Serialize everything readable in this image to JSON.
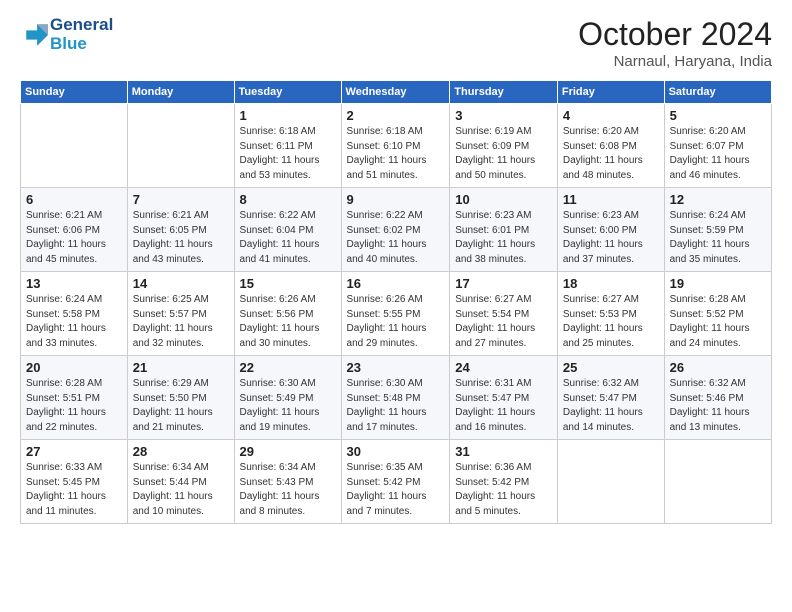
{
  "header": {
    "logo_line1": "General",
    "logo_line2": "Blue",
    "month": "October 2024",
    "location": "Narnaul, Haryana, India"
  },
  "weekdays": [
    "Sunday",
    "Monday",
    "Tuesday",
    "Wednesday",
    "Thursday",
    "Friday",
    "Saturday"
  ],
  "weeks": [
    [
      {
        "day": "",
        "info": ""
      },
      {
        "day": "",
        "info": ""
      },
      {
        "day": "1",
        "info": "Sunrise: 6:18 AM\nSunset: 6:11 PM\nDaylight: 11 hours\nand 53 minutes."
      },
      {
        "day": "2",
        "info": "Sunrise: 6:18 AM\nSunset: 6:10 PM\nDaylight: 11 hours\nand 51 minutes."
      },
      {
        "day": "3",
        "info": "Sunrise: 6:19 AM\nSunset: 6:09 PM\nDaylight: 11 hours\nand 50 minutes."
      },
      {
        "day": "4",
        "info": "Sunrise: 6:20 AM\nSunset: 6:08 PM\nDaylight: 11 hours\nand 48 minutes."
      },
      {
        "day": "5",
        "info": "Sunrise: 6:20 AM\nSunset: 6:07 PM\nDaylight: 11 hours\nand 46 minutes."
      }
    ],
    [
      {
        "day": "6",
        "info": "Sunrise: 6:21 AM\nSunset: 6:06 PM\nDaylight: 11 hours\nand 45 minutes."
      },
      {
        "day": "7",
        "info": "Sunrise: 6:21 AM\nSunset: 6:05 PM\nDaylight: 11 hours\nand 43 minutes."
      },
      {
        "day": "8",
        "info": "Sunrise: 6:22 AM\nSunset: 6:04 PM\nDaylight: 11 hours\nand 41 minutes."
      },
      {
        "day": "9",
        "info": "Sunrise: 6:22 AM\nSunset: 6:02 PM\nDaylight: 11 hours\nand 40 minutes."
      },
      {
        "day": "10",
        "info": "Sunrise: 6:23 AM\nSunset: 6:01 PM\nDaylight: 11 hours\nand 38 minutes."
      },
      {
        "day": "11",
        "info": "Sunrise: 6:23 AM\nSunset: 6:00 PM\nDaylight: 11 hours\nand 37 minutes."
      },
      {
        "day": "12",
        "info": "Sunrise: 6:24 AM\nSunset: 5:59 PM\nDaylight: 11 hours\nand 35 minutes."
      }
    ],
    [
      {
        "day": "13",
        "info": "Sunrise: 6:24 AM\nSunset: 5:58 PM\nDaylight: 11 hours\nand 33 minutes."
      },
      {
        "day": "14",
        "info": "Sunrise: 6:25 AM\nSunset: 5:57 PM\nDaylight: 11 hours\nand 32 minutes."
      },
      {
        "day": "15",
        "info": "Sunrise: 6:26 AM\nSunset: 5:56 PM\nDaylight: 11 hours\nand 30 minutes."
      },
      {
        "day": "16",
        "info": "Sunrise: 6:26 AM\nSunset: 5:55 PM\nDaylight: 11 hours\nand 29 minutes."
      },
      {
        "day": "17",
        "info": "Sunrise: 6:27 AM\nSunset: 5:54 PM\nDaylight: 11 hours\nand 27 minutes."
      },
      {
        "day": "18",
        "info": "Sunrise: 6:27 AM\nSunset: 5:53 PM\nDaylight: 11 hours\nand 25 minutes."
      },
      {
        "day": "19",
        "info": "Sunrise: 6:28 AM\nSunset: 5:52 PM\nDaylight: 11 hours\nand 24 minutes."
      }
    ],
    [
      {
        "day": "20",
        "info": "Sunrise: 6:28 AM\nSunset: 5:51 PM\nDaylight: 11 hours\nand 22 minutes."
      },
      {
        "day": "21",
        "info": "Sunrise: 6:29 AM\nSunset: 5:50 PM\nDaylight: 11 hours\nand 21 minutes."
      },
      {
        "day": "22",
        "info": "Sunrise: 6:30 AM\nSunset: 5:49 PM\nDaylight: 11 hours\nand 19 minutes."
      },
      {
        "day": "23",
        "info": "Sunrise: 6:30 AM\nSunset: 5:48 PM\nDaylight: 11 hours\nand 17 minutes."
      },
      {
        "day": "24",
        "info": "Sunrise: 6:31 AM\nSunset: 5:47 PM\nDaylight: 11 hours\nand 16 minutes."
      },
      {
        "day": "25",
        "info": "Sunrise: 6:32 AM\nSunset: 5:47 PM\nDaylight: 11 hours\nand 14 minutes."
      },
      {
        "day": "26",
        "info": "Sunrise: 6:32 AM\nSunset: 5:46 PM\nDaylight: 11 hours\nand 13 minutes."
      }
    ],
    [
      {
        "day": "27",
        "info": "Sunrise: 6:33 AM\nSunset: 5:45 PM\nDaylight: 11 hours\nand 11 minutes."
      },
      {
        "day": "28",
        "info": "Sunrise: 6:34 AM\nSunset: 5:44 PM\nDaylight: 11 hours\nand 10 minutes."
      },
      {
        "day": "29",
        "info": "Sunrise: 6:34 AM\nSunset: 5:43 PM\nDaylight: 11 hours\nand 8 minutes."
      },
      {
        "day": "30",
        "info": "Sunrise: 6:35 AM\nSunset: 5:42 PM\nDaylight: 11 hours\nand 7 minutes."
      },
      {
        "day": "31",
        "info": "Sunrise: 6:36 AM\nSunset: 5:42 PM\nDaylight: 11 hours\nand 5 minutes."
      },
      {
        "day": "",
        "info": ""
      },
      {
        "day": "",
        "info": ""
      }
    ]
  ]
}
